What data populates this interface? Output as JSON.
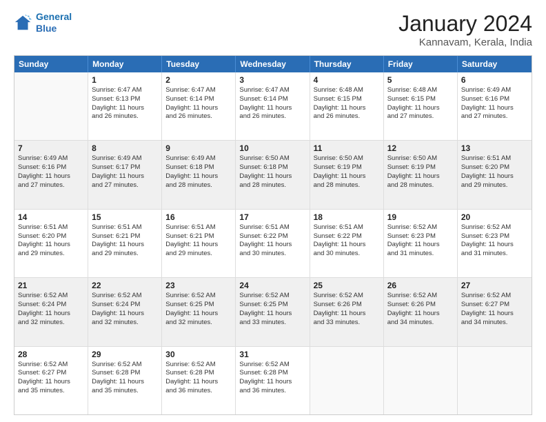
{
  "header": {
    "logo_line1": "General",
    "logo_line2": "Blue",
    "title": "January 2024",
    "subtitle": "Kannavam, Kerala, India"
  },
  "calendar": {
    "days": [
      "Sunday",
      "Monday",
      "Tuesday",
      "Wednesday",
      "Thursday",
      "Friday",
      "Saturday"
    ],
    "weeks": [
      [
        {
          "day": "",
          "info": ""
        },
        {
          "day": "1",
          "info": "Sunrise: 6:47 AM\nSunset: 6:13 PM\nDaylight: 11 hours\nand 26 minutes."
        },
        {
          "day": "2",
          "info": "Sunrise: 6:47 AM\nSunset: 6:14 PM\nDaylight: 11 hours\nand 26 minutes."
        },
        {
          "day": "3",
          "info": "Sunrise: 6:47 AM\nSunset: 6:14 PM\nDaylight: 11 hours\nand 26 minutes."
        },
        {
          "day": "4",
          "info": "Sunrise: 6:48 AM\nSunset: 6:15 PM\nDaylight: 11 hours\nand 26 minutes."
        },
        {
          "day": "5",
          "info": "Sunrise: 6:48 AM\nSunset: 6:15 PM\nDaylight: 11 hours\nand 27 minutes."
        },
        {
          "day": "6",
          "info": "Sunrise: 6:49 AM\nSunset: 6:16 PM\nDaylight: 11 hours\nand 27 minutes."
        }
      ],
      [
        {
          "day": "7",
          "info": "Sunrise: 6:49 AM\nSunset: 6:16 PM\nDaylight: 11 hours\nand 27 minutes."
        },
        {
          "day": "8",
          "info": "Sunrise: 6:49 AM\nSunset: 6:17 PM\nDaylight: 11 hours\nand 27 minutes."
        },
        {
          "day": "9",
          "info": "Sunrise: 6:49 AM\nSunset: 6:18 PM\nDaylight: 11 hours\nand 28 minutes."
        },
        {
          "day": "10",
          "info": "Sunrise: 6:50 AM\nSunset: 6:18 PM\nDaylight: 11 hours\nand 28 minutes."
        },
        {
          "day": "11",
          "info": "Sunrise: 6:50 AM\nSunset: 6:19 PM\nDaylight: 11 hours\nand 28 minutes."
        },
        {
          "day": "12",
          "info": "Sunrise: 6:50 AM\nSunset: 6:19 PM\nDaylight: 11 hours\nand 28 minutes."
        },
        {
          "day": "13",
          "info": "Sunrise: 6:51 AM\nSunset: 6:20 PM\nDaylight: 11 hours\nand 29 minutes."
        }
      ],
      [
        {
          "day": "14",
          "info": "Sunrise: 6:51 AM\nSunset: 6:20 PM\nDaylight: 11 hours\nand 29 minutes."
        },
        {
          "day": "15",
          "info": "Sunrise: 6:51 AM\nSunset: 6:21 PM\nDaylight: 11 hours\nand 29 minutes."
        },
        {
          "day": "16",
          "info": "Sunrise: 6:51 AM\nSunset: 6:21 PM\nDaylight: 11 hours\nand 29 minutes."
        },
        {
          "day": "17",
          "info": "Sunrise: 6:51 AM\nSunset: 6:22 PM\nDaylight: 11 hours\nand 30 minutes."
        },
        {
          "day": "18",
          "info": "Sunrise: 6:51 AM\nSunset: 6:22 PM\nDaylight: 11 hours\nand 30 minutes."
        },
        {
          "day": "19",
          "info": "Sunrise: 6:52 AM\nSunset: 6:23 PM\nDaylight: 11 hours\nand 31 minutes."
        },
        {
          "day": "20",
          "info": "Sunrise: 6:52 AM\nSunset: 6:23 PM\nDaylight: 11 hours\nand 31 minutes."
        }
      ],
      [
        {
          "day": "21",
          "info": "Sunrise: 6:52 AM\nSunset: 6:24 PM\nDaylight: 11 hours\nand 32 minutes."
        },
        {
          "day": "22",
          "info": "Sunrise: 6:52 AM\nSunset: 6:24 PM\nDaylight: 11 hours\nand 32 minutes."
        },
        {
          "day": "23",
          "info": "Sunrise: 6:52 AM\nSunset: 6:25 PM\nDaylight: 11 hours\nand 32 minutes."
        },
        {
          "day": "24",
          "info": "Sunrise: 6:52 AM\nSunset: 6:25 PM\nDaylight: 11 hours\nand 33 minutes."
        },
        {
          "day": "25",
          "info": "Sunrise: 6:52 AM\nSunset: 6:26 PM\nDaylight: 11 hours\nand 33 minutes."
        },
        {
          "day": "26",
          "info": "Sunrise: 6:52 AM\nSunset: 6:26 PM\nDaylight: 11 hours\nand 34 minutes."
        },
        {
          "day": "27",
          "info": "Sunrise: 6:52 AM\nSunset: 6:27 PM\nDaylight: 11 hours\nand 34 minutes."
        }
      ],
      [
        {
          "day": "28",
          "info": "Sunrise: 6:52 AM\nSunset: 6:27 PM\nDaylight: 11 hours\nand 35 minutes."
        },
        {
          "day": "29",
          "info": "Sunrise: 6:52 AM\nSunset: 6:28 PM\nDaylight: 11 hours\nand 35 minutes."
        },
        {
          "day": "30",
          "info": "Sunrise: 6:52 AM\nSunset: 6:28 PM\nDaylight: 11 hours\nand 36 minutes."
        },
        {
          "day": "31",
          "info": "Sunrise: 6:52 AM\nSunset: 6:28 PM\nDaylight: 11 hours\nand 36 minutes."
        },
        {
          "day": "",
          "info": ""
        },
        {
          "day": "",
          "info": ""
        },
        {
          "day": "",
          "info": ""
        }
      ]
    ]
  }
}
